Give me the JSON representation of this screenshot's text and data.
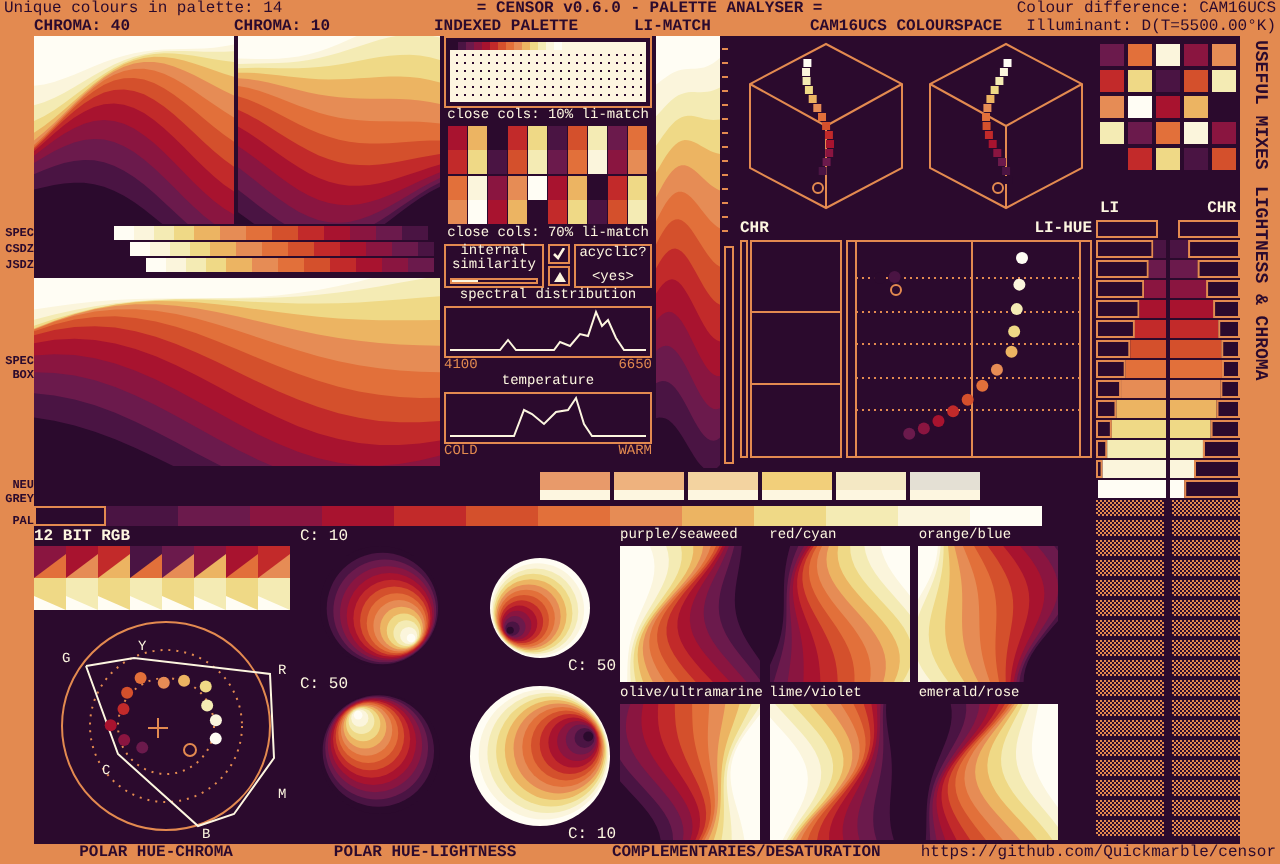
{
  "header": {
    "unique_count": "Unique colours in palette: 14",
    "title": "= CENSOR v0.6.0 - PALETTE ANALYSER =",
    "colour_difference": "Colour difference: CAM16UCS",
    "illuminant": "Illuminant: D(T=5500.00°K)"
  },
  "section_labels": {
    "chroma_40": "CHROMA: 40",
    "chroma_10": "CHROMA: 10",
    "indexed_palette": "INDEXED PALETTE",
    "li_match": "LI-MATCH",
    "colourspace": "CAM16UCS COLOURSPACE"
  },
  "spectrum_rows": [
    {
      "label": "SPEC"
    },
    {
      "label": "CSDZ"
    },
    {
      "label": "JSDZ"
    }
  ],
  "spec_box": {
    "label_lines": [
      "SPEC",
      "BOX"
    ]
  },
  "neutral_grey": {
    "label_lines": [
      "NEU",
      "GREY"
    ],
    "swatches": [
      {
        "color": "#e89a6a"
      },
      {
        "color": "#eeb27e"
      },
      {
        "color": "#f3d3a0"
      },
      {
        "color": "#f2cf7a"
      },
      {
        "color": "#f4e8c4"
      },
      {
        "color": "#e4e0d4"
      }
    ]
  },
  "palette": {
    "label": "PAL",
    "colors": [
      {
        "color": "#2b0a2d"
      },
      {
        "color": "#4a1443"
      },
      {
        "color": "#6b1a4c"
      },
      {
        "color": "#8a1540"
      },
      {
        "color": "#a8132f"
      },
      {
        "color": "#c22a2a"
      },
      {
        "color": "#d4502c"
      },
      {
        "color": "#e2703a"
      },
      {
        "color": "#e68c55"
      },
      {
        "color": "#ecb462"
      },
      {
        "color": "#efd986"
      },
      {
        "color": "#f4ebb4"
      },
      {
        "color": "#fbf5dc"
      },
      {
        "color": "#fffdf4"
      }
    ]
  },
  "indexed": {
    "close_10": "close cols: 10% li-match",
    "close_70": "close cols: 70% li-match",
    "internal_similarity": {
      "label": "internal similarity",
      "level": 0.3
    },
    "similarity_checked": true,
    "acyclic": {
      "label": "acyclic?",
      "value": "<yes>"
    },
    "spectral": {
      "title": "spectral distribution",
      "min": "4100",
      "max": "6650"
    },
    "temperature": {
      "title": "temperature",
      "min": "COLD",
      "max": "WARM"
    }
  },
  "li_hue": {
    "chr_label": "CHR",
    "li_hue_label": "LI-HUE"
  },
  "li_chr": {
    "li_label": "LI",
    "chr_label": "CHR"
  },
  "side_titles": [
    "USEFUL MIXES",
    "LIGHTNESS & CHROMA"
  ],
  "rgb12": {
    "label": "12 BIT RGB"
  },
  "polar_hue_chroma": {
    "title": "POLAR HUE-CHROMA",
    "axis_labels": [
      {
        "text": "G"
      },
      {
        "text": "Y"
      },
      {
        "text": "R"
      },
      {
        "text": "C"
      },
      {
        "text": "M"
      },
      {
        "text": "B"
      }
    ]
  },
  "polar_hue_lightness": {
    "title": "POLAR HUE-LIGHTNESS",
    "plots": [
      {
        "label": "C: 10"
      },
      {
        "label": "C: 50"
      },
      {
        "label": "C: 50"
      },
      {
        "label": "C: 10"
      }
    ]
  },
  "complementaries": {
    "title": "COMPLEMENTARIES/DESATURATION",
    "pairs": [
      {
        "label": "purple/seaweed"
      },
      {
        "label": "red/cyan"
      },
      {
        "label": "orange/blue"
      },
      {
        "label": "olive/ultramarine"
      },
      {
        "label": "lime/violet"
      },
      {
        "label": "emerald/rose"
      }
    ]
  },
  "footer_url": "https://github.com/Quickmarble/censor"
}
